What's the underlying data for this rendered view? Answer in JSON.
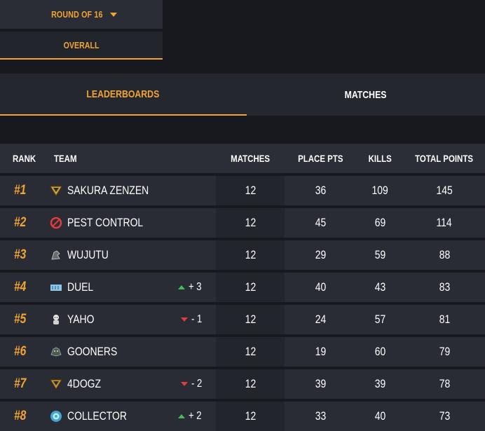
{
  "filters": {
    "round_label": "ROUND OF 16",
    "overall_label": "OVERALL"
  },
  "tabs": [
    {
      "label": "LEADERBOARDS",
      "active": true
    },
    {
      "label": "MATCHES",
      "active": false
    }
  ],
  "table": {
    "headers": {
      "rank": "RANK",
      "team": "TEAM",
      "matches": "MATCHES",
      "place_pts": "PLACE PTS",
      "kills": "KILLS",
      "total_points": "TOTAL POINTS"
    },
    "rows": [
      {
        "rank": "#1",
        "team": "SAKURA ZENZEN",
        "logo": "sakura-zenzen-logo",
        "change": "",
        "change_dir": "",
        "matches": "12",
        "place_pts": "36",
        "kills": "109",
        "total_points": "145"
      },
      {
        "rank": "#2",
        "team": "PEST CONTROL",
        "logo": "pest-control-logo",
        "change": "",
        "change_dir": "",
        "matches": "12",
        "place_pts": "45",
        "kills": "69",
        "total_points": "114"
      },
      {
        "rank": "#3",
        "team": "WUJUTU",
        "logo": "wujutu-logo",
        "change": "",
        "change_dir": "",
        "matches": "12",
        "place_pts": "29",
        "kills": "59",
        "total_points": "88"
      },
      {
        "rank": "#4",
        "team": "DUEL",
        "logo": "duel-logo",
        "change": "+ 3",
        "change_dir": "up",
        "matches": "12",
        "place_pts": "40",
        "kills": "43",
        "total_points": "83"
      },
      {
        "rank": "#5",
        "team": "YAHO",
        "logo": "yaho-logo",
        "change": "- 1",
        "change_dir": "down",
        "matches": "12",
        "place_pts": "24",
        "kills": "57",
        "total_points": "81"
      },
      {
        "rank": "#6",
        "team": "GOONERS",
        "logo": "gooners-logo",
        "change": "",
        "change_dir": "",
        "matches": "12",
        "place_pts": "19",
        "kills": "60",
        "total_points": "79"
      },
      {
        "rank": "#7",
        "team": "4DOGZ",
        "logo": "4dogz-logo",
        "change": "- 2",
        "change_dir": "down",
        "matches": "12",
        "place_pts": "39",
        "kills": "39",
        "total_points": "78"
      },
      {
        "rank": "#8",
        "team": "COLLECTOR",
        "logo": "collector-logo",
        "change": "+ 2",
        "change_dir": "up",
        "matches": "12",
        "place_pts": "33",
        "kills": "40",
        "total_points": "73"
      }
    ]
  },
  "colors": {
    "accent": "#f0a431",
    "up": "#3fbf4c",
    "down": "#e23b3b",
    "background": "#18191e"
  }
}
